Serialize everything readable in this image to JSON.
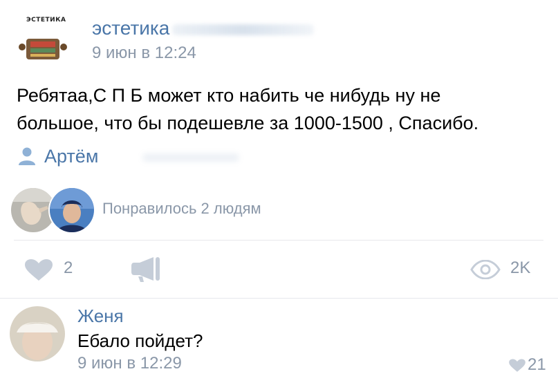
{
  "post": {
    "group_avatar_text": "ЭСТЕТИКА",
    "group_name": "эстетика",
    "date": "9 июн в 12:24",
    "text_line1": "Ребятаа,С П Б может кто набить че нибудь ну не",
    "text_line2": "большое, что бы подешевле за 1000-1500 , Спасибо.",
    "signer_name": "Артём"
  },
  "likes_summary": {
    "text": "Понравилось 2 людям"
  },
  "actions": {
    "like_count": "2",
    "views_count": "2K"
  },
  "comment": {
    "author": "Женя",
    "text": "Ебало пойдет?",
    "date": "9 июн в 12:29",
    "like_count": "21"
  },
  "icons": {
    "like": "heart-icon",
    "share": "megaphone-icon",
    "views": "eye-icon",
    "signer": "person-icon"
  },
  "colors": {
    "link_blue": "#4a76a8",
    "secondary_gray": "#8a97a8",
    "icon_gray": "#c5cdd8",
    "divider": "#e7e8ec"
  }
}
